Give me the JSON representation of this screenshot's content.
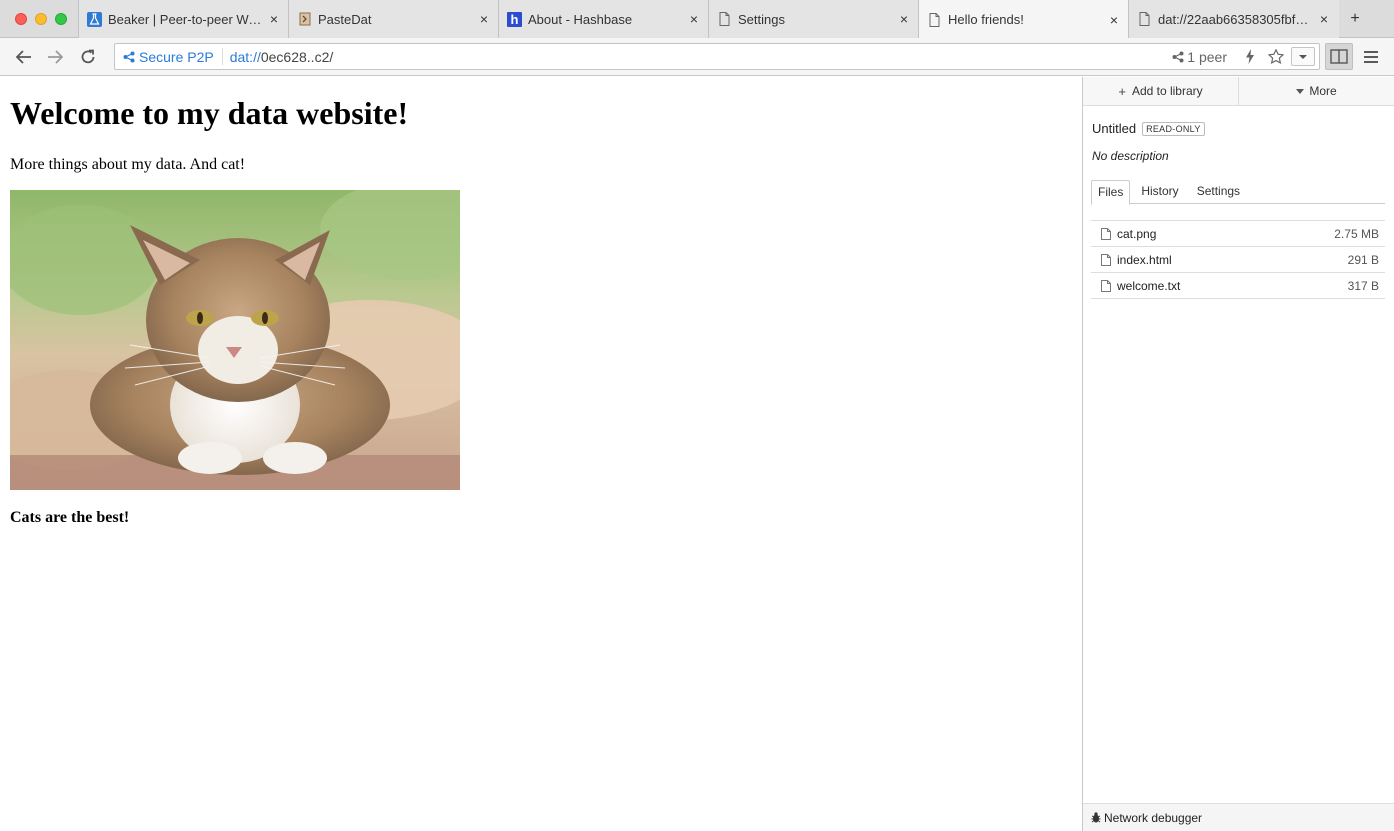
{
  "tabs": [
    {
      "title": "Beaker | Peer-to-peer We...",
      "icon": "beaker-icon"
    },
    {
      "title": "PasteDat",
      "icon": "pastedat-icon"
    },
    {
      "title": "About - Hashbase",
      "icon": "hashbase-icon"
    },
    {
      "title": "Settings",
      "icon": "page-icon"
    },
    {
      "title": "Hello friends!",
      "icon": "page-icon",
      "active": true
    },
    {
      "title": "dat://22aab66358305fbfa...",
      "icon": "page-icon"
    }
  ],
  "tab_close_glyph": "×",
  "new_tab_glyph": "+",
  "navbar": {
    "secure_label": "Secure P2P",
    "url_protocol": "dat://",
    "url_rest": "0ec628..c2/",
    "peers": "1 peer"
  },
  "page": {
    "heading": "Welcome to my data website!",
    "paragraph": "More things about my data. And cat!",
    "caption": "Cats are the best!"
  },
  "sidebar": {
    "add_to_library": "Add to library",
    "more": "More",
    "title": "Untitled",
    "badge": "READ-ONLY",
    "description": "No description",
    "tabs": [
      "Files",
      "History",
      "Settings"
    ],
    "files": [
      {
        "name": "cat.png",
        "size": "2.75 MB"
      },
      {
        "name": "index.html",
        "size": "291 B"
      },
      {
        "name": "welcome.txt",
        "size": "317 B"
      }
    ],
    "footer": "Network debugger"
  },
  "colors": {
    "accent": "#2b7bd8",
    "traffic_red": "#fc5f57",
    "traffic_yellow": "#fdbc2e",
    "traffic_green": "#33c748"
  }
}
